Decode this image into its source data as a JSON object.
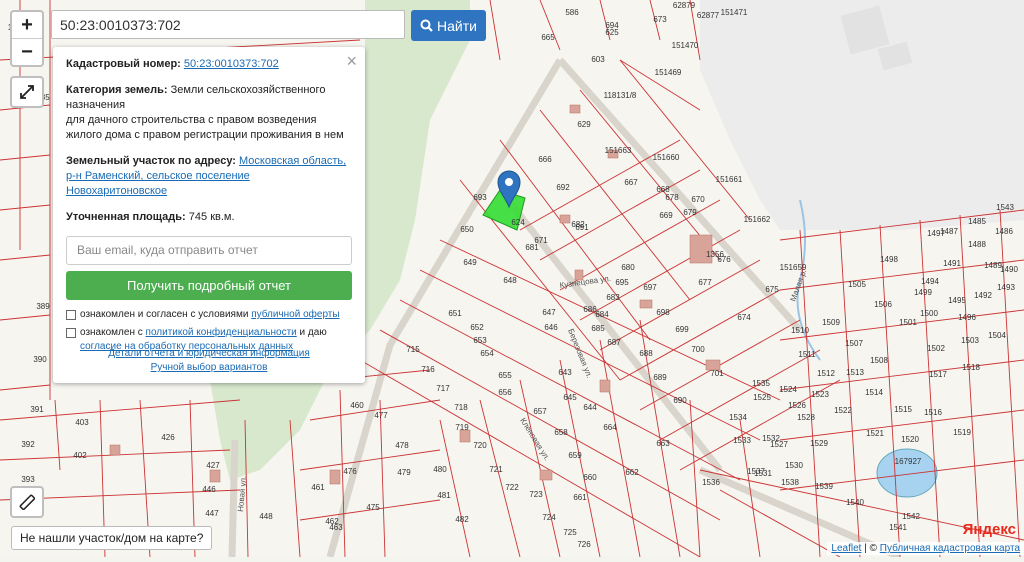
{
  "colors": {
    "accent": "#2f74c0",
    "report_button": "#4cae4f",
    "parcel_line": "#cc3333",
    "selected_parcel": "#33dd33",
    "pin": "#2f74c0"
  },
  "search": {
    "value": "50:23:0010373:702",
    "button_label": "Найти",
    "button_icon": "search-icon"
  },
  "zoom": {
    "in": "+",
    "out": "−"
  },
  "panel": {
    "cadastral_label": "Кадастровый номер:",
    "cadastral_value": "50:23:0010373:702",
    "category_label": "Категория земель:",
    "category_value": "Земли сельскохозяйственного назначения",
    "category_usage": "для дачного строительства с правом возведения жилого дома с правом регистрации проживания в нем",
    "address_label": "Земельный участок по адресу:",
    "address_value": "Московская область, р-н Раменский, сельское поселение Новохаритоновское",
    "area_label": "Уточненная площадь:",
    "area_value": "745 кв.м.",
    "email_placeholder": "Ваш email, куда отправить отчет",
    "report_button": "Получить подробный отчет",
    "consent1_text": "ознакомлен и согласен с условиями ",
    "consent1_link": "публичной оферты",
    "consent2_text": "ознакомлен с ",
    "consent2_link": "политикой конфиденциальности",
    "consent2_text2": " и даю ",
    "consent2_link2": "согласие на обработку персональных данных",
    "details_link": "Детали отчета и юридическая информация",
    "manual_link": "Ручной выбор вариантов"
  },
  "footer": {
    "not_found": "Не нашли участок/дом на карте?",
    "yandex_logo": "Яндекс",
    "attribution_leaflet": "Leaflet",
    "attribution_sep": " | © ",
    "attribution_pkk": "Публичная кадастровая карта"
  },
  "map": {
    "streets": [
      "Кузнецова ул.",
      "Березовая ул.",
      "Кленовая ул.",
      "Новая ул.",
      "Малая р."
    ],
    "parcels": [
      "586",
      "673",
      "694",
      "665",
      "603",
      "625",
      "629",
      "666",
      "692",
      "693",
      "624",
      "671",
      "682",
      "681",
      "686",
      "691",
      "695",
      "697",
      "698",
      "699",
      "700",
      "701",
      "680",
      "683",
      "684",
      "685",
      "687",
      "688",
      "689",
      "690",
      "643",
      "644",
      "645",
      "646",
      "647",
      "648",
      "649",
      "650",
      "651",
      "652",
      "653",
      "654",
      "655",
      "656",
      "657",
      "658",
      "659",
      "660",
      "661",
      "662",
      "663",
      "664",
      "667",
      "668",
      "669",
      "670",
      "674",
      "675",
      "676",
      "677",
      "678",
      "679",
      "715",
      "716",
      "717",
      "718",
      "719",
      "720",
      "721",
      "722",
      "723",
      "724",
      "725",
      "726",
      "460",
      "477",
      "478",
      "479",
      "480",
      "481",
      "482",
      "461",
      "462",
      "463",
      "475",
      "476",
      "446",
      "447",
      "448",
      "426",
      "427",
      "402",
      "403",
      "392",
      "393",
      "390",
      "391",
      "389",
      "385",
      "1356",
      "1485",
      "1486",
      "1487",
      "1488",
      "1489",
      "1490",
      "1491",
      "1492",
      "1493",
      "1494",
      "1495",
      "1496",
      "1497",
      "1498",
      "1499",
      "1500",
      "1501",
      "1502",
      "1503",
      "1504",
      "1505",
      "1506",
      "1507",
      "1508",
      "1509",
      "1510",
      "1511",
      "1512",
      "1513",
      "1514",
      "1515",
      "1516",
      "1517",
      "1518",
      "1519",
      "1520",
      "1521",
      "1522",
      "1523",
      "1524",
      "1525",
      "1526",
      "1527",
      "1528",
      "1529",
      "1530",
      "1531",
      "1532",
      "1533",
      "1534",
      "1535",
      "1536",
      "1537",
      "1538",
      "1539",
      "1540",
      "1541",
      "1542",
      "1543",
      "151471",
      "151470",
      "151469",
      "151661",
      "151662",
      "151659",
      "151660",
      "151663",
      "118131/8",
      "167927",
      "62879",
      "62877",
      "1"
    ]
  }
}
